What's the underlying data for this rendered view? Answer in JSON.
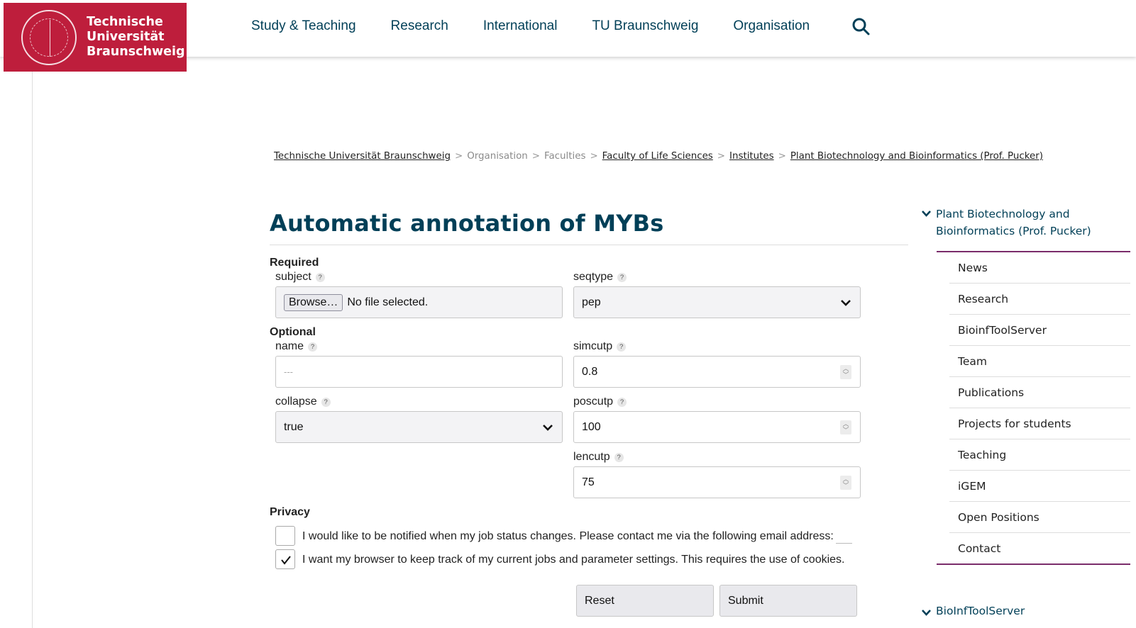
{
  "header": {
    "logo_lines": [
      "Technische",
      "Universität",
      "Braunschweig"
    ],
    "nav": [
      "Study & Teaching",
      "Research",
      "International",
      "TU Braunschweig",
      "Organisation"
    ],
    "search_icon": "search-icon"
  },
  "breadcrumb": [
    {
      "label": "Technische Universität Braunschweig",
      "link": true
    },
    {
      "label": "Organisation",
      "link": false
    },
    {
      "label": "Faculties",
      "link": false
    },
    {
      "label": "Faculty of Life Sciences",
      "link": true
    },
    {
      "label": "Institutes",
      "link": true
    },
    {
      "label": "Plant Biotechnology and Bioinformatics (Prof. Pucker)",
      "link": true
    }
  ],
  "breadcrumb_sep": ">",
  "main": {
    "title": "Automatic annotation of MYBs",
    "required_label": "Required",
    "optional_label": "Optional",
    "privacy_label": "Privacy",
    "help_glyph": "?",
    "fields": {
      "subject": {
        "label": "subject",
        "button": "Browse…",
        "value": "No file selected."
      },
      "seqtype": {
        "label": "seqtype",
        "value": "pep"
      },
      "name": {
        "label": "name",
        "placeholder": "---"
      },
      "simcutp": {
        "label": "simcutp",
        "value": "0.8"
      },
      "collapse": {
        "label": "collapse",
        "value": "true"
      },
      "poscutp": {
        "label": "poscutp",
        "value": "100"
      },
      "lencutp": {
        "label": "lencutp",
        "value": "75"
      }
    },
    "privacy": {
      "notify": {
        "label": "I would like to be notified when my job status changes. Please contact me via the following email address:",
        "checked": false
      },
      "cookies": {
        "label": "I want my browser to keep track of my current jobs and parameter settings. This requires the use of cookies.",
        "checked": true
      }
    },
    "buttons": {
      "reset": "Reset",
      "submit": "Submit"
    }
  },
  "sidebar": {
    "heading": "Plant Biotechnology and Bioinformatics (Prof. Pucker)",
    "items": [
      "News",
      "Research",
      "BioinfToolServer",
      "Team",
      "Publications",
      "Projects for students",
      "Teaching",
      "iGEM",
      "Open Positions",
      "Contact"
    ],
    "heading2": "BioInfToolServer"
  },
  "colors": {
    "brand_red": "#be1e3c",
    "nav_blue": "#003f57",
    "sidebar_accent": "#7b2c6b"
  }
}
